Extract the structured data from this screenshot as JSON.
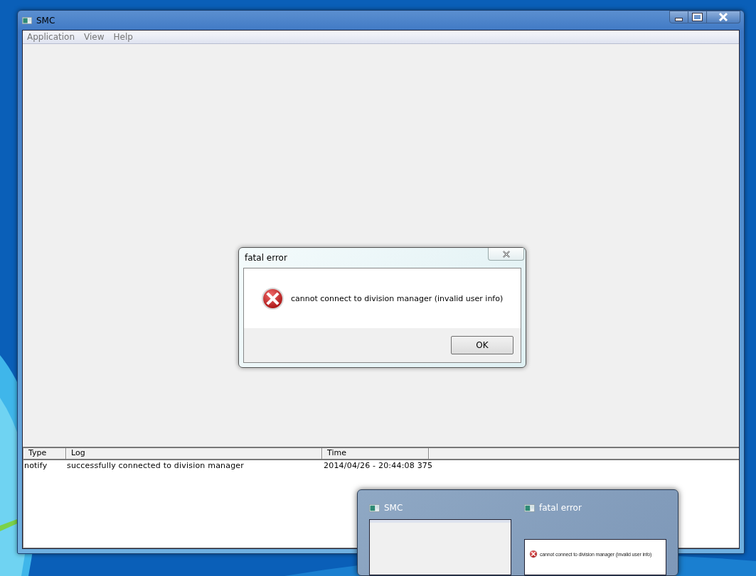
{
  "window": {
    "title": "SMC"
  },
  "menu": [
    {
      "label": "Application"
    },
    {
      "label": "View"
    },
    {
      "label": "Help"
    }
  ],
  "log": {
    "columns": [
      "Type",
      "Log",
      "Time"
    ],
    "rows": [
      {
        "type": "notify",
        "log": "successfully connected to division manager",
        "time": "2014/04/26 - 20:44:08 375"
      }
    ]
  },
  "dialog": {
    "title": "fatal error",
    "message": "cannot connect to division manager (invalid user info)",
    "button": "OK"
  },
  "taskbar_preview": [
    {
      "kind": "window",
      "title": "SMC"
    },
    {
      "kind": "dialog",
      "title": "fatal error",
      "message": "cannot connect to division manager (invalid user info)"
    }
  ]
}
